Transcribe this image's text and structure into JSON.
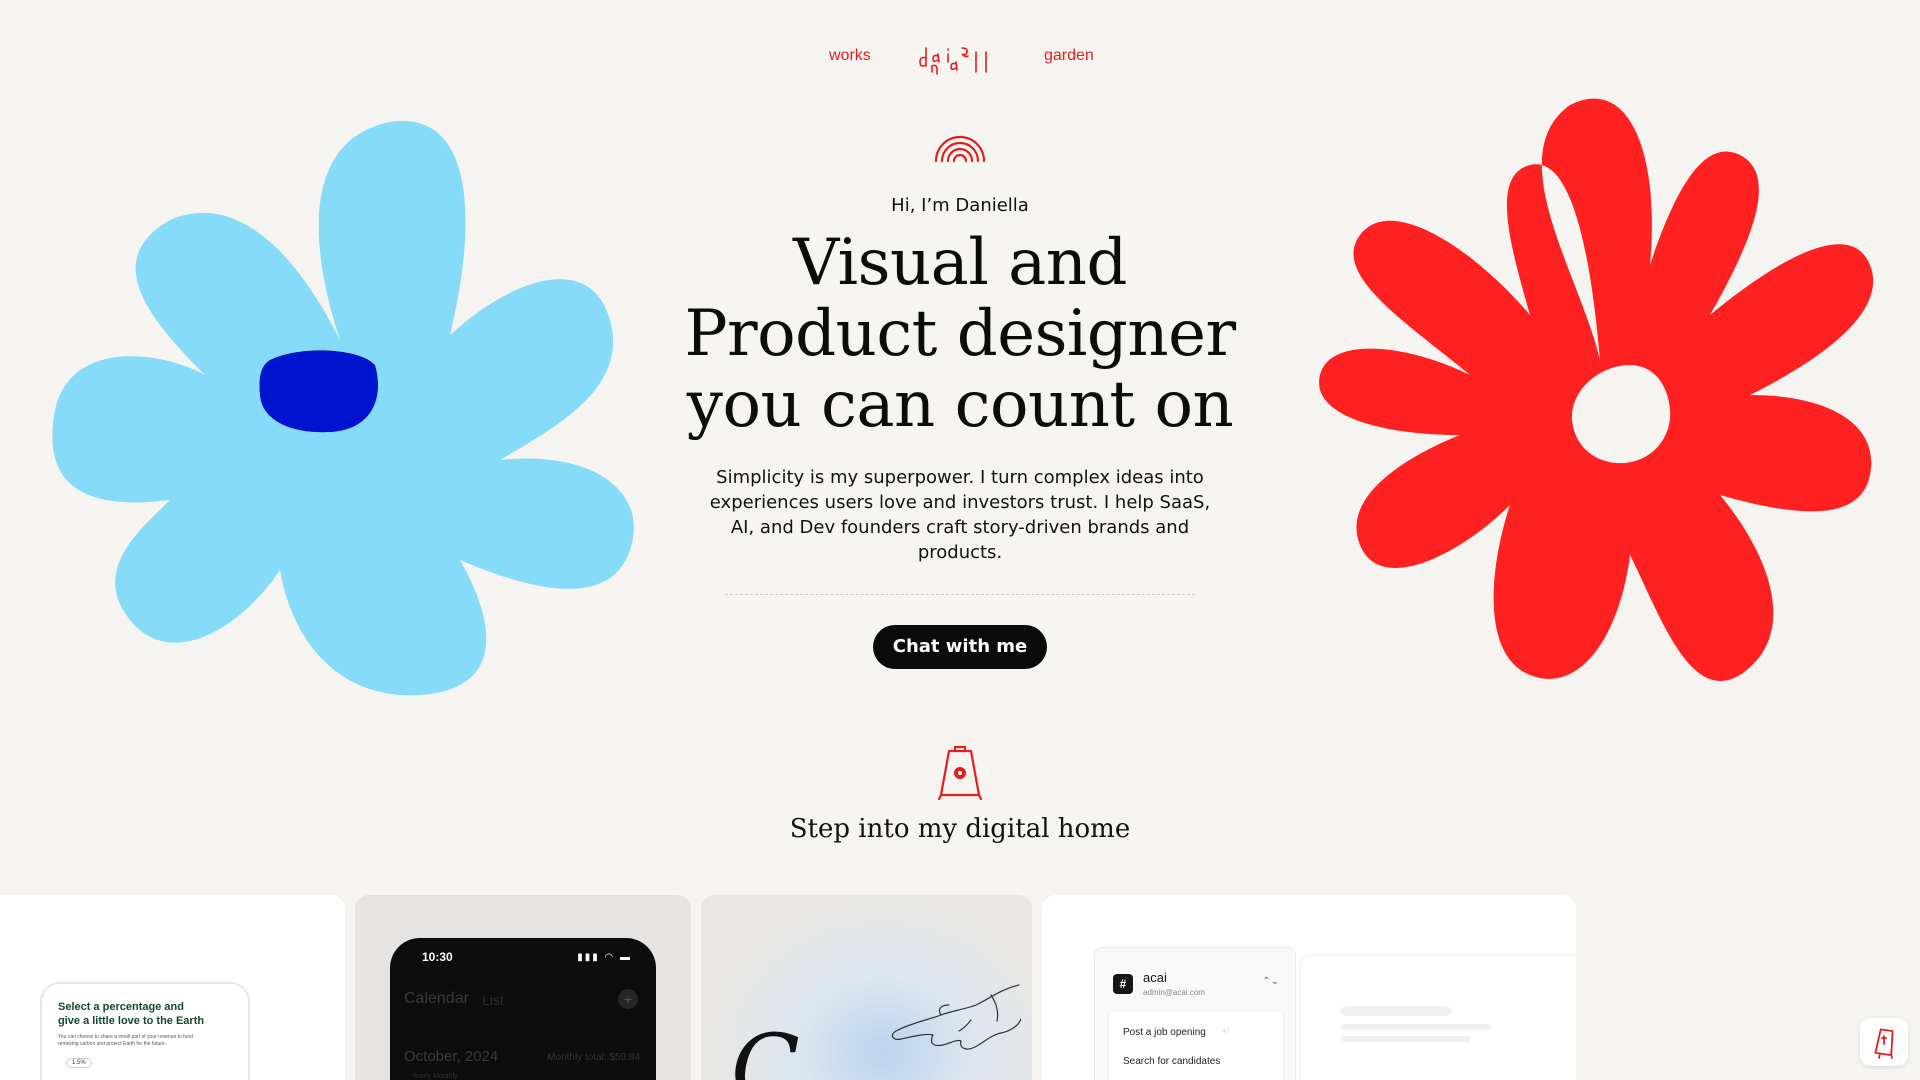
{
  "nav": {
    "works_label": "works",
    "garden_label": "garden",
    "logo_text": "daniella"
  },
  "hero": {
    "greeting": "Hi, I’m Daniella",
    "headline_lines": [
      "Visual and",
      "Product designer",
      "you can count on"
    ],
    "description": "Simplicity is my superpower. I turn complex ideas into experiences users love and investors trust. I help SaaS, AI, and Dev founders craft story-driven brands and products.",
    "cta_label": "Chat with me"
  },
  "home": {
    "title": "Step into my digital home"
  },
  "cards": {
    "eco": {
      "title": "Select a percentage and give a little love to the Earth",
      "body": "You can choose to share a small part of your revenue to fund removing carbon and protect Earth for the future.",
      "percentage": "1.5%"
    },
    "calendar": {
      "time": "10:30",
      "tab_active": "Calendar",
      "tab_inactive": "List",
      "month": "October, 2024",
      "monthly_total": "Monthly total: $59.84",
      "sub_tabs": "Yearly   Monthly"
    },
    "art": {
      "letter": "C"
    },
    "app": {
      "workspace": "acai",
      "email": "admin@acai.com",
      "menu_items": [
        "Post a job opening",
        "Search for candidates"
      ]
    }
  },
  "colors": {
    "background": "#f6f4f1",
    "accent_red": "#e21f1f",
    "flower_blue": "#86dcf8",
    "flower_blue_center": "#0014d0",
    "flower_red": "#fe2121",
    "button_dark": "#0b0b0b"
  },
  "icons": {
    "hero": "rainbow-icon",
    "home": "a-frame-sign-icon",
    "fab": "sign-icon"
  }
}
